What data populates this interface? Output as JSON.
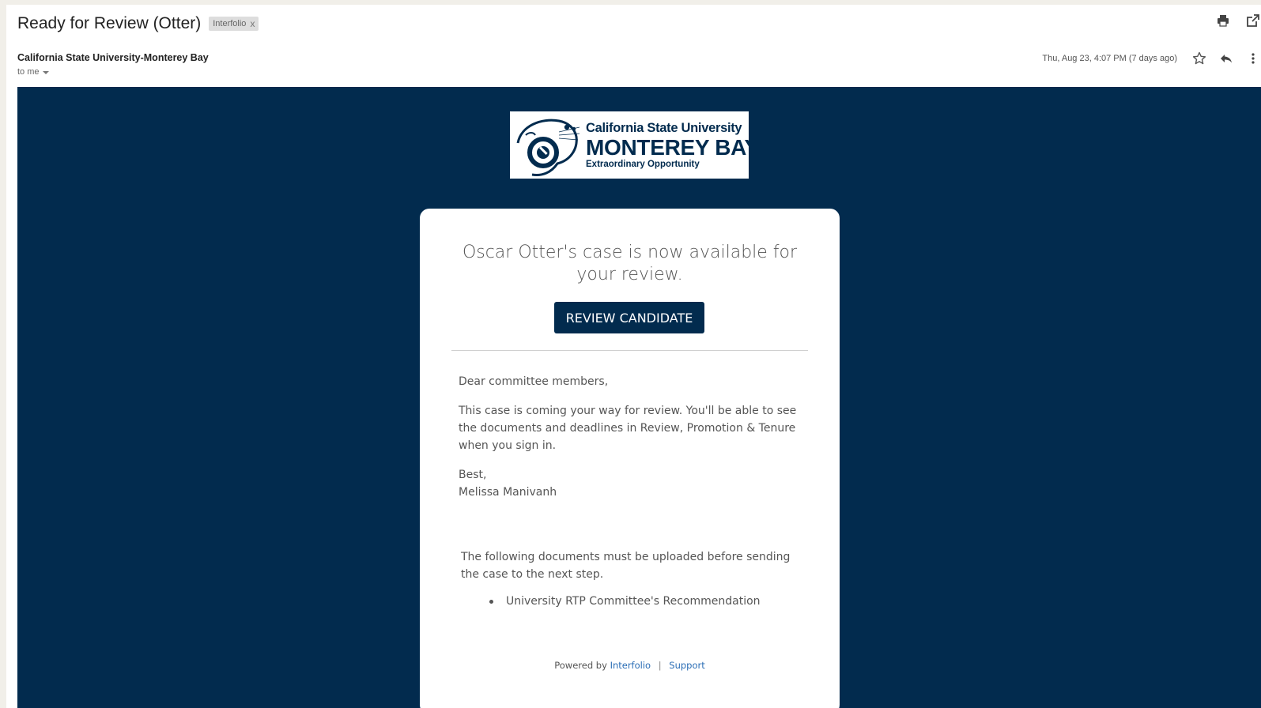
{
  "email": {
    "subject": "Ready for Review (Otter)",
    "label": "Interfolio",
    "label_remove": "x",
    "sender": "California State University-Monterey Bay",
    "recipient": "to me",
    "date": "Thu, Aug 23, 4:07 PM (7 days ago)"
  },
  "toolbar": {
    "print_icon": "print-icon",
    "new_window_icon": "open-in-new-window-icon",
    "star_icon": "star-icon",
    "reply_icon": "reply-icon",
    "more_icon": "more-vertical-icon"
  },
  "logo": {
    "line1": "California State University",
    "line2": "MONTEREY BAY",
    "line3": "Extraordinary Opportunity"
  },
  "card": {
    "headline": "Oscar Otter's case is now available for your review.",
    "button_label": "REVIEW CANDIDATE",
    "greeting": "Dear committee members,",
    "body": "This case is coming your way for review. You'll be able to see the documents and deadlines in Review, Promotion & Tenure when you sign in.",
    "closing": "Best,",
    "signer": "Melissa Manivanh",
    "docs_intro": "The following documents must be uploaded before sending the case to the next step.",
    "docs": [
      "University RTP Committee's Recommendation"
    ],
    "footer_prefix": "Powered by",
    "footer_link1": "Interfolio",
    "footer_sep": "|",
    "footer_link2": "Support"
  },
  "colors": {
    "navy": "#022b4e",
    "link": "#2a6db5",
    "background": "#f1efe9"
  }
}
